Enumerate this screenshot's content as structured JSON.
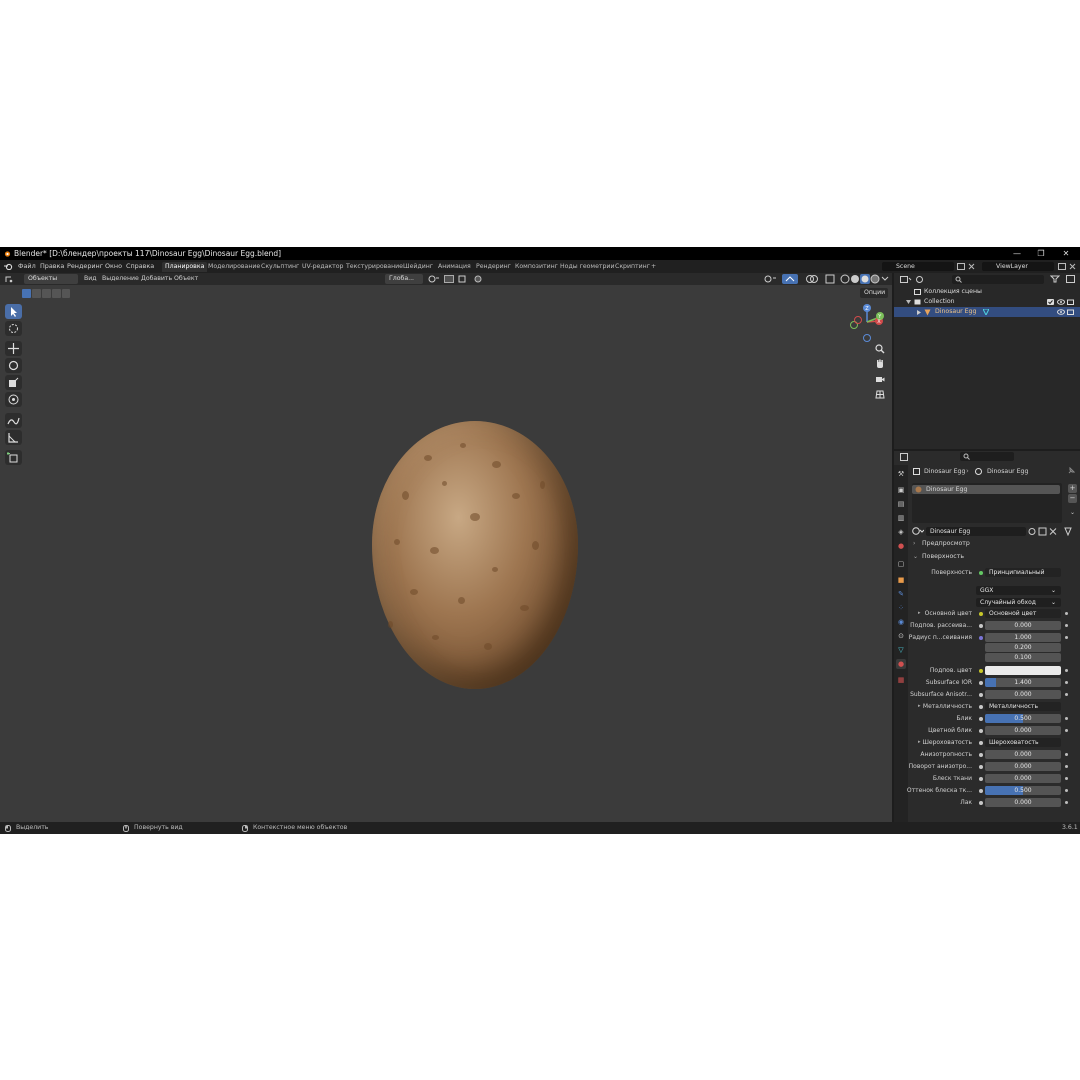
{
  "window": {
    "title": "Blender* [D:\\блендер\\проекты 117\\Dinosaur Egg\\Dinosaur Egg.blend]",
    "minimize": "—",
    "maximize": "❐",
    "close": "✕"
  },
  "menu": [
    "Файл",
    "Правка",
    "Рендеринг",
    "Окно",
    "Справка"
  ],
  "workspaces": [
    "Планировка",
    "Моделирование",
    "Скульптинг",
    "UV-редактор",
    "Текстурирование",
    "Шейдинг",
    "Анимация",
    "Рендеринг",
    "Композитинг",
    "Ноды геометрии",
    "Скриптинг",
    "+"
  ],
  "scene_field": "Scene",
  "viewlayer_field": "ViewLayer",
  "viewport": {
    "mode": "Объекты",
    "menus": [
      "Вид",
      "Выделение",
      "Добавить",
      "Объект"
    ],
    "transform_orientation": "Глоба...",
    "options": "Опции",
    "gizmo_axes": {
      "x": "X",
      "y": "Y",
      "z": "Z"
    }
  },
  "outliner": {
    "scene_collection": "Коллекция сцены",
    "collection": "Collection",
    "object": "Dinosaur Egg"
  },
  "properties": {
    "breadcrumb_object": "Dinosaur Egg",
    "breadcrumb_material": "Dinosaur Egg",
    "material_slot": "Dinosaur Egg",
    "material_name": "Dinosaur Egg",
    "preview_panel": "Предпросмотр",
    "surface_panel": "Поверхность",
    "rows": {
      "surface_label": "Поверхность",
      "surface_value": "Принципиальный BSDF",
      "distribution": "GGX",
      "subsurface_method": "Случайный обход",
      "base_color_label": "Основной цвет",
      "base_color_value": "Основной цвет",
      "subsurface_label": "Подпов. рассеива...",
      "subsurface_value": "0.000",
      "radius_label": "Радиус п...сеивания",
      "radius_x": "1.000",
      "radius_y": "0.200",
      "radius_z": "0.100",
      "subsurface_color_label": "Подпов. цвет",
      "ior_label": "Subsurface IOR",
      "ior_value": "1.400",
      "aniso_label": "Subsurface Anisotr...",
      "aniso_value": "0.000",
      "metallic_label": "Металличность",
      "metallic_value": "Металличность",
      "specular_label": "Блик",
      "specular_value": "0.500",
      "spec_tint_label": "Цветной блик",
      "spec_tint_value": "0.000",
      "roughness_label": "Шероховатость",
      "roughness_value": "Шероховатость",
      "anisotropic_label": "Анизотропность",
      "anisotropic_value": "0.000",
      "aniso_rot_label": "Поворот анизотро...",
      "aniso_rot_value": "0.000",
      "sheen_label": "Блеск ткани",
      "sheen_value": "0.000",
      "sheen_tint_label": "Оттенок блеска тк...",
      "sheen_tint_value": "0.500",
      "clearcoat_label": "Лак",
      "clearcoat_value": "0.000"
    },
    "fill_fractions": {
      "ior": 0.14,
      "specular": 0.5,
      "sheen_tint": 0.5
    }
  },
  "status": {
    "select": "Выделить",
    "rotate": "Повернуть вид",
    "context": "Контекстное меню объектов",
    "version": "3.6.1"
  },
  "colors": {
    "accent": "#4772b3",
    "selection": "#334d80",
    "viewport_bg": "#3b3b3b",
    "egg": "#a8784c"
  }
}
